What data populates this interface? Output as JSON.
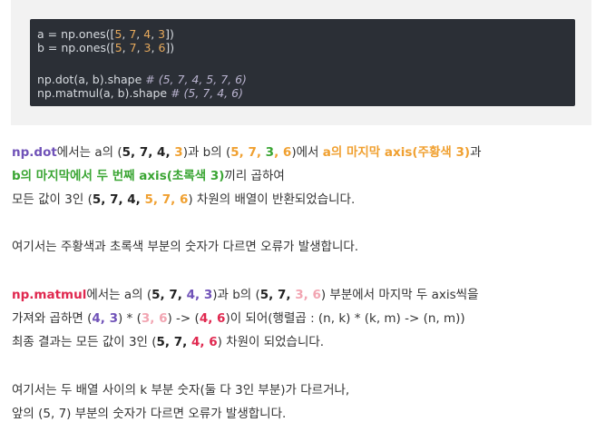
{
  "code": {
    "line1": {
      "pre": "a = np.ones([",
      "nums": [
        "5",
        "7",
        "4",
        "3"
      ],
      "post": "])"
    },
    "line2": {
      "pre": "b = np.ones([",
      "nums": [
        "5",
        "7",
        "3",
        "6"
      ],
      "post": "])"
    },
    "line3": {
      "code": "np.dot(a, b).shape ",
      "comment": "# (5, 7, 4, 5, 7, 6)"
    },
    "line4": {
      "code": "np.matmul(a, b).shape ",
      "comment": "# (5, 7, 4, 6)"
    }
  },
  "para1": {
    "l1": {
      "func": "np.dot",
      "t1": "에서는 a의 (",
      "a_shape": {
        "d1": "5, 7, 4, ",
        "d2": "3"
      },
      "t2": ")과 b의 (",
      "b_shape": {
        "d1": "5, 7, ",
        "d2": "3",
        "sep": ", ",
        "d3": "6"
      },
      "t3": ")에서 ",
      "hl": "a의 마지막 axis(주황색 3)",
      "t4": "과"
    },
    "l2": {
      "hl": "b의 마지막에서 두 번째 axis(초록색 3)",
      "t": "끼리 곱하여"
    },
    "l3": {
      "t1": "모든 값이 3인 (",
      "r1": "5, 7, 4, ",
      "r2": "5, 7, 6",
      "t2": ") 차원의 배열이 반환되었습니다."
    }
  },
  "para2": {
    "text": "여기서는 주황색과 초록색 부분의 숫자가 다르면 오류가 발생합니다."
  },
  "para3": {
    "l1": {
      "func": "np.matmul",
      "t1": "에서는 a의 (",
      "a_shape": {
        "d1": "5, 7, ",
        "d2": "4, 3"
      },
      "t2": ")과 b의 (",
      "b_shape": {
        "d1": "5, 7, ",
        "d2": "3, 6"
      },
      "t3": ") 부분에서 마지막 두 axis씩을"
    },
    "l2": {
      "t1": "가져와 곱하면 (",
      "m1": "4, 3",
      "t2": ") * (",
      "m2": "3, 6",
      "t3": ") -> (",
      "m3": "4, 6",
      "t4": ")이 되어(행렬곱 : (n, k) * (k, m) -> (n, m))"
    },
    "l3": {
      "t1": "최종 결과는 모든 값이 3인 (",
      "r1": "5, 7, ",
      "r2": "4, 6",
      "t2": ") 차원이 되었습니다."
    }
  },
  "para4": {
    "l1": "여기서는 두 배열 사이의 k 부분 숫자(둘 다 3인 부분)가 다르거나,",
    "l2": "앞의 (5, 7) 부분의 숫자가 다르면 오류가 발생합니다."
  }
}
